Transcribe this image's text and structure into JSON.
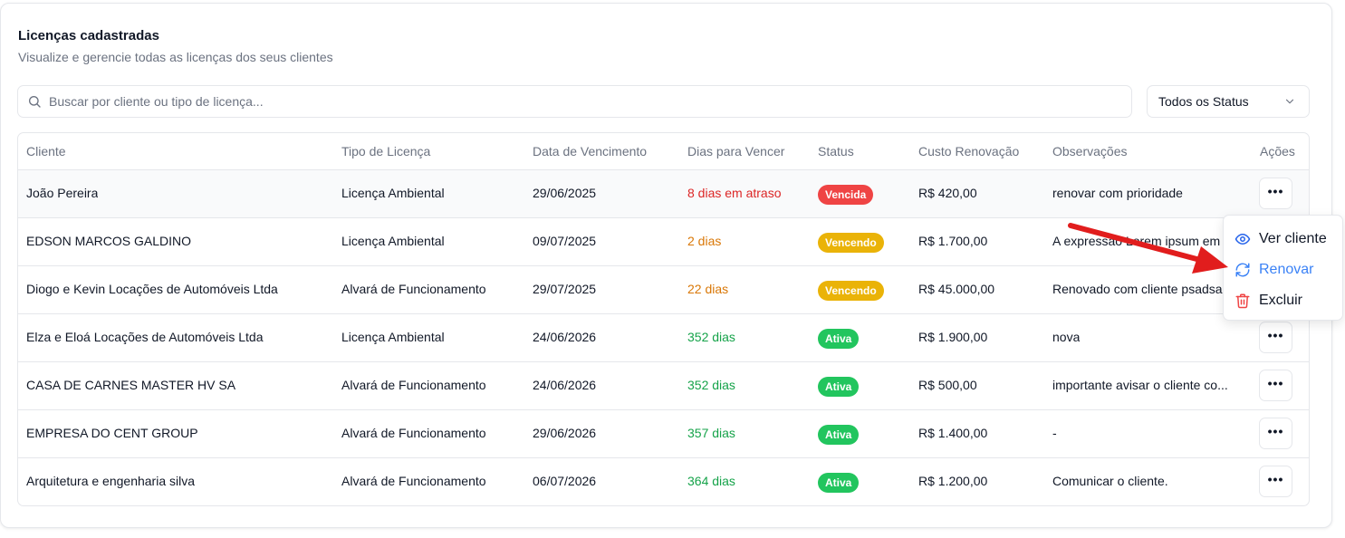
{
  "header": {
    "title": "Licenças cadastradas",
    "subtitle": "Visualize e gerencie todas as licenças dos seus clientes"
  },
  "search": {
    "placeholder": "Buscar por cliente ou tipo de licença...",
    "value": ""
  },
  "status_filter": {
    "selected": "Todos os Status"
  },
  "table": {
    "columns": [
      "Cliente",
      "Tipo de Licença",
      "Data de Vencimento",
      "Dias para Vencer",
      "Status",
      "Custo Renovação",
      "Observações",
      "Ações"
    ],
    "rows": [
      {
        "cliente": "João Pereira",
        "tipo": "Licença Ambiental",
        "vencimento": "29/06/2025",
        "dias": "8 dias em atraso",
        "status": "Vencida",
        "custo": "R$ 420,00",
        "obs": "renovar com prioridade"
      },
      {
        "cliente": "EDSON MARCOS GALDINO",
        "tipo": "Licença Ambiental",
        "vencimento": "09/07/2025",
        "dias": "2 dias",
        "status": "Vencendo",
        "custo": "R$ 1.700,00",
        "obs": "A expressão Lorem ipsum em"
      },
      {
        "cliente": "Diogo e Kevin Locações de Automóveis Ltda",
        "tipo": "Alvará de Funcionamento",
        "vencimento": "29/07/2025",
        "dias": "22 dias",
        "status": "Vencendo",
        "custo": "R$ 45.000,00",
        "obs": "Renovado com cliente psadsa"
      },
      {
        "cliente": "Elza e Eloá Locações de Automóveis Ltda",
        "tipo": "Licença Ambiental",
        "vencimento": "24/06/2026",
        "dias": "352 dias",
        "status": "Ativa",
        "custo": "R$ 1.900,00",
        "obs": "nova"
      },
      {
        "cliente": "CASA DE CARNES MASTER HV SA",
        "tipo": "Alvará de Funcionamento",
        "vencimento": "24/06/2026",
        "dias": "352 dias",
        "status": "Ativa",
        "custo": "R$ 500,00",
        "obs": "importante avisar o cliente co..."
      },
      {
        "cliente": "EMPRESA DO CENT GROUP",
        "tipo": "Alvará de Funcionamento",
        "vencimento": "29/06/2026",
        "dias": "357 dias",
        "status": "Ativa",
        "custo": "R$ 1.400,00",
        "obs": "-"
      },
      {
        "cliente": "Arquitetura e engenharia silva",
        "tipo": "Alvará de Funcionamento",
        "vencimento": "06/07/2026",
        "dias": "364 dias",
        "status": "Ativa",
        "custo": "R$ 1.200,00",
        "obs": "Comunicar o cliente."
      }
    ]
  },
  "actions_menu": {
    "items": [
      {
        "label": "Ver cliente",
        "icon": "eye-icon"
      },
      {
        "label": "Renovar",
        "icon": "refresh-icon"
      },
      {
        "label": "Excluir",
        "icon": "trash-icon"
      }
    ]
  },
  "colors": {
    "overdue": "#dc2626",
    "due_soon": "#d97706",
    "active": "#16a34a",
    "badge_vencida": "#ef4444",
    "badge_vencendo": "#eab308",
    "badge_ativa": "#22c55e",
    "menu_accent": "#3b82f6",
    "annotation_arrow": "#e11d1d"
  }
}
